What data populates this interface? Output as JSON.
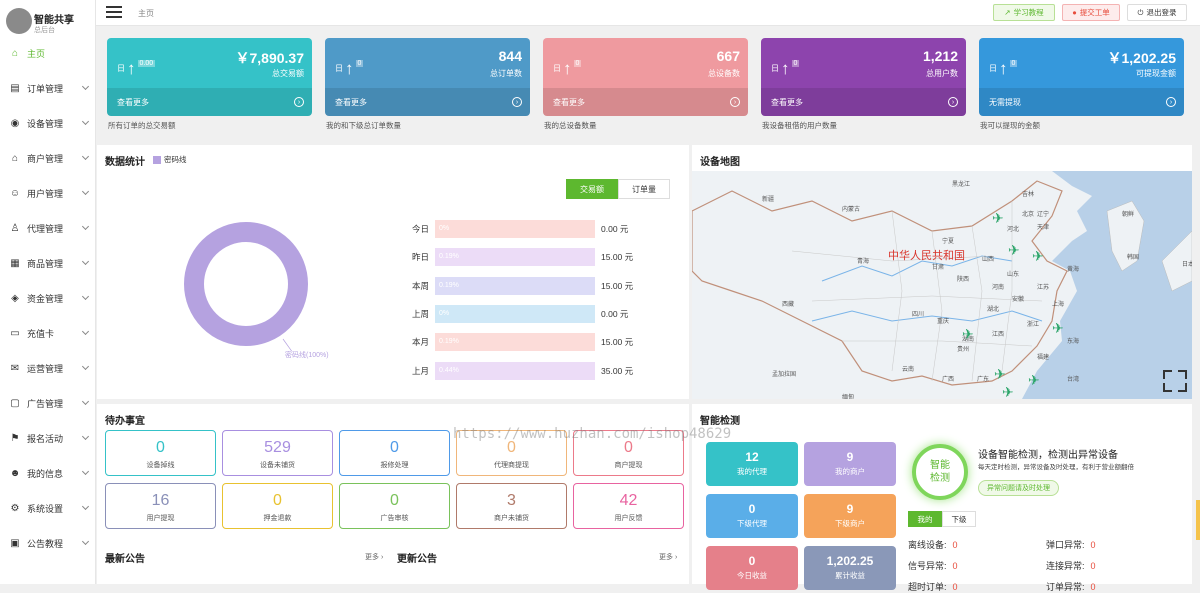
{
  "brand": {
    "title": "智能共享",
    "subtitle": "总后台"
  },
  "sidebar": {
    "items": [
      {
        "label": "主页",
        "icon": "home-icon",
        "active": true
      },
      {
        "label": "订单管理",
        "icon": "order-icon"
      },
      {
        "label": "设备管理",
        "icon": "device-icon"
      },
      {
        "label": "商户管理",
        "icon": "store-icon"
      },
      {
        "label": "用户管理",
        "icon": "user-icon"
      },
      {
        "label": "代理管理",
        "icon": "agent-icon"
      },
      {
        "label": "商品管理",
        "icon": "goods-icon"
      },
      {
        "label": "资金管理",
        "icon": "money-icon"
      },
      {
        "label": "充值卡",
        "icon": "card-icon"
      },
      {
        "label": "运营管理",
        "icon": "operation-icon"
      },
      {
        "label": "广告管理",
        "icon": "ad-icon"
      },
      {
        "label": "报名活动",
        "icon": "activity-icon"
      },
      {
        "label": "我的信息",
        "icon": "profile-icon"
      },
      {
        "label": "系统设置",
        "icon": "settings-icon"
      },
      {
        "label": "公告教程",
        "icon": "notice-icon"
      }
    ]
  },
  "header": {
    "breadcrumb": "主页",
    "tutorial": "学习教程",
    "ticket": "提交工单",
    "logout": "退出登录"
  },
  "stats": [
    {
      "value": "￥7,890.37",
      "label": "总交易额",
      "day": "日",
      "pct": "0.00",
      "footer": "查看更多",
      "desc": "所有订单的总交易额",
      "color": "#35c2c8"
    },
    {
      "value": "844",
      "label": "总订单数",
      "day": "日",
      "pct": "0",
      "footer": "查看更多",
      "desc": "我的和下级总订单数量",
      "color": "#4f9ac8"
    },
    {
      "value": "667",
      "label": "总设备数",
      "day": "日",
      "pct": "0",
      "footer": "查看更多",
      "desc": "我的总设备数量",
      "color": "#ef9a9f"
    },
    {
      "value": "1,212",
      "label": "总用户数",
      "day": "日",
      "pct": "0",
      "footer": "查看更多",
      "desc": "我设备租借的用户数量",
      "color": "#8d44ad"
    },
    {
      "value": "￥1,202.25",
      "label": "可提现金额",
      "day": "日",
      "pct": "0",
      "footer": "无需提现",
      "desc": "我可以提现的金额",
      "color": "#3598dc"
    }
  ],
  "data_stats": {
    "title": "数据统计",
    "legend": "密码线",
    "tab_amount": "交易额",
    "tab_orders": "订单量",
    "donut_label": "密码线(100%)",
    "rows": [
      {
        "label": "今日",
        "pct_text": "0%",
        "value": "0.00 元",
        "fill": 0,
        "color": "#fcdcd9"
      },
      {
        "label": "昨日",
        "pct_text": "0.19%",
        "value": "15.00 元",
        "fill": 0.0019,
        "color": "#ecdcf7"
      },
      {
        "label": "本周",
        "pct_text": "0.19%",
        "value": "15.00 元",
        "fill": 0.0019,
        "color": "#dcdcf7"
      },
      {
        "label": "上周",
        "pct_text": "0%",
        "value": "0.00 元",
        "fill": 0,
        "color": "#cfe8f7"
      },
      {
        "label": "本月",
        "pct_text": "0.19%",
        "value": "15.00 元",
        "fill": 0.0019,
        "color": "#fcdcd9"
      },
      {
        "label": "上月",
        "pct_text": "0.44%",
        "value": "35.00 元",
        "fill": 0.0044,
        "color": "#ecdcf7"
      }
    ]
  },
  "chart_data": {
    "type": "pie",
    "categories": [
      "密码线"
    ],
    "values": [
      100
    ],
    "donut": true,
    "colors": [
      "#b5a2e0"
    ]
  },
  "map": {
    "title": "设备地图",
    "country": "中华人民共和国",
    "places": [
      "新疆",
      "内蒙古",
      "黑龙江",
      "吉林",
      "辽宁",
      "北京",
      "天津",
      "河北",
      "山西",
      "朝鲜",
      "韩国",
      "日本",
      "宁夏",
      "青海",
      "甘肃",
      "陕西",
      "山东",
      "河南",
      "江苏",
      "安徽",
      "上海",
      "湖北",
      "西藏",
      "四川",
      "重庆",
      "湖南",
      "江西",
      "浙江",
      "贵州",
      "云南",
      "广西",
      "广东",
      "福建",
      "台湾",
      "东海",
      "黄海",
      "孟加拉国",
      "缅甸"
    ]
  },
  "todo": {
    "title": "待办事宜",
    "items": [
      {
        "value": "0",
        "label": "设备掉线",
        "color": "#35c2c8"
      },
      {
        "value": "529",
        "label": "设备未铺货",
        "color": "#a88fe0"
      },
      {
        "value": "0",
        "label": "报修处理",
        "color": "#4f9ae8"
      },
      {
        "value": "0",
        "label": "代理商提现",
        "color": "#f0b67a"
      },
      {
        "value": "0",
        "label": "商户提现",
        "color": "#ec7a8a"
      },
      {
        "value": "16",
        "label": "用户提现",
        "color": "#8a90b8"
      },
      {
        "value": "0",
        "label": "押金退款",
        "color": "#e8c230"
      },
      {
        "value": "0",
        "label": "广告审核",
        "color": "#7ac25b"
      },
      {
        "value": "3",
        "label": "商户未铺货",
        "color": "#b07a6a"
      },
      {
        "value": "42",
        "label": "用户反馈",
        "color": "#e863a0"
      }
    ],
    "notice": "最新公告",
    "notice_more": "更多",
    "news": "更新公告",
    "news_more": "更多"
  },
  "detect": {
    "title": "智能检测",
    "cards": [
      {
        "value": "12",
        "label": "我的代理",
        "color": "#35c2c8"
      },
      {
        "value": "9",
        "label": "我的商户",
        "color": "#b5a2e0"
      },
      {
        "value": "0",
        "label": "下级代理",
        "color": "#5aaee8"
      },
      {
        "value": "9",
        "label": "下级商户",
        "color": "#f5a35a"
      },
      {
        "value": "0",
        "label": "今日收益",
        "color": "#e5808a"
      },
      {
        "value": "1,202.25",
        "label": "累计收益",
        "color": "#8a98b8"
      }
    ],
    "circle1": "智能",
    "circle2": "检测",
    "heading": "设备智能检测，检测出异常设备",
    "sub": "每天定时检测，异常设备及时处理，有利于营业额翻倍",
    "button": "异常问题请及时处理",
    "tab_mine": "我的",
    "tab_sub": "下级",
    "abnormal": [
      {
        "label": "离线设备:",
        "value": "0"
      },
      {
        "label": "弹口异常:",
        "value": "0"
      },
      {
        "label": "信号异常:",
        "value": "0"
      },
      {
        "label": "连接异常:",
        "value": "0"
      },
      {
        "label": "超时订单:",
        "value": "0"
      },
      {
        "label": "订单异常:",
        "value": "0"
      }
    ]
  },
  "watermark": "https://www.huzhan.com/ishop48629"
}
